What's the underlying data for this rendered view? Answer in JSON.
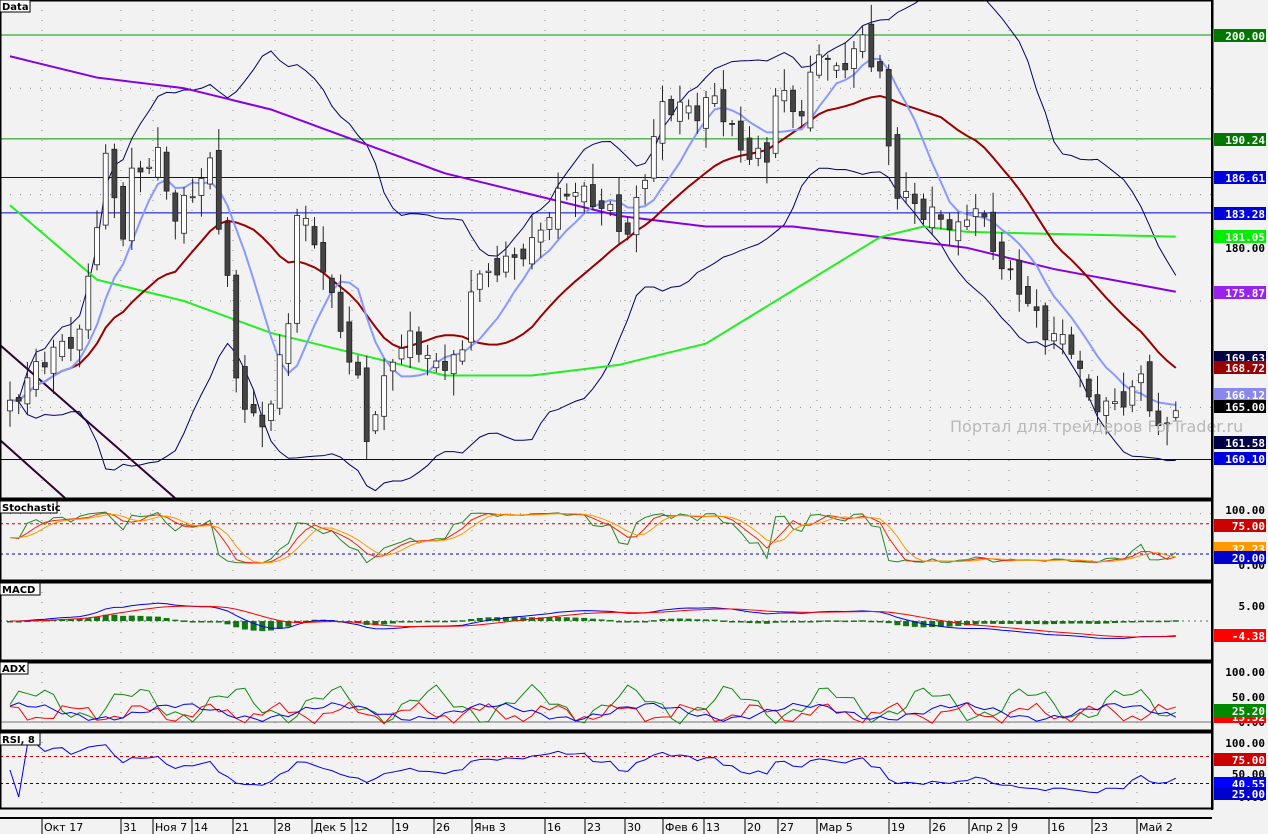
{
  "panels": {
    "data": "Data",
    "stochastic": "Stochastic",
    "macd": "MACD",
    "adx": "ADX",
    "rsi": "RSI, 8"
  },
  "watermark": "Портал для трейдеров ForTrader.ru",
  "price_axis": {
    "ticks": [
      "180.00",
      "165.00"
    ],
    "tags": [
      {
        "text": "200.00",
        "bg": "#007700"
      },
      {
        "text": "190.24",
        "bg": "#007700"
      },
      {
        "text": "186.61",
        "bg": "#0000dd"
      },
      {
        "text": "183.28",
        "bg": "#0000dd"
      },
      {
        "text": "181.05",
        "bg": "#00ee00"
      },
      {
        "text": "175.87",
        "bg": "#9922ee"
      },
      {
        "text": "169.63",
        "bg": "#000044"
      },
      {
        "text": "168.72",
        "bg": "#990000"
      },
      {
        "text": "166.12",
        "bg": "#8888ee"
      },
      {
        "text": "165.00",
        "bg": "#000000"
      },
      {
        "text": "161.58",
        "bg": "#000044"
      },
      {
        "text": "160.10",
        "bg": "#0000dd"
      }
    ]
  },
  "stoch_axis": {
    "ticks": [
      "100.00",
      "0.00"
    ],
    "tags": [
      {
        "text": "75.00",
        "bg": "#cc0000"
      },
      {
        "text": "32.23",
        "bg": "#ff9900"
      },
      {
        "text": "20.00",
        "bg": "#0000cc"
      }
    ]
  },
  "macd_axis": {
    "ticks": [
      "5.00"
    ],
    "tags": [
      {
        "text": "-4.38",
        "bg": "#ff0000"
      }
    ]
  },
  "adx_axis": {
    "ticks": [
      "100.00",
      "50.00",
      "0.00"
    ],
    "tags": [
      {
        "text": "25.20",
        "bg": "#008800"
      },
      {
        "text": "15.52",
        "bg": "#ff0000"
      }
    ]
  },
  "rsi_axis": {
    "ticks": [
      "100.00",
      "50.00",
      "0.00"
    ],
    "tags": [
      {
        "text": "75.00",
        "bg": "#cc0000"
      },
      {
        "text": "40.55",
        "bg": "#0000ff"
      },
      {
        "text": "25.00",
        "bg": "#0000cc"
      }
    ]
  },
  "dates": [
    "Окт 17",
    "31",
    "Ноя 7",
    "14",
    "21",
    "28",
    "Дек 5",
    "12",
    "19",
    "26",
    "Янв 3",
    "16",
    "23",
    "30",
    "Фев 6",
    "13",
    "20",
    "27",
    "Мар 5",
    "19",
    "26",
    "Апр 2",
    "9",
    "16",
    "23",
    "Май 2"
  ],
  "chart_data": {
    "type": "candlestick",
    "bars": 135,
    "ylim": [
      155,
      202
    ],
    "close_keypoints": [
      [
        0,
        165
      ],
      [
        3,
        168
      ],
      [
        8,
        172
      ],
      [
        11,
        189
      ],
      [
        13,
        182
      ],
      [
        14,
        187
      ],
      [
        17,
        188
      ],
      [
        19,
        182
      ],
      [
        23,
        188
      ],
      [
        25,
        178
      ],
      [
        26,
        168
      ],
      [
        29,
        163
      ],
      [
        32,
        172
      ],
      [
        33,
        183
      ],
      [
        36,
        178
      ],
      [
        37,
        175
      ],
      [
        40,
        168
      ],
      [
        41,
        163
      ],
      [
        44,
        170
      ],
      [
        46,
        171
      ],
      [
        49,
        168
      ],
      [
        52,
        170
      ],
      [
        53,
        177
      ],
      [
        56,
        179
      ],
      [
        60,
        180
      ],
      [
        63,
        184
      ],
      [
        65,
        185
      ],
      [
        69,
        184
      ],
      [
        71,
        182
      ],
      [
        75,
        193
      ],
      [
        79,
        192
      ],
      [
        81,
        194
      ],
      [
        84,
        190
      ],
      [
        87,
        189
      ],
      [
        88,
        195
      ],
      [
        91,
        192
      ],
      [
        93,
        198
      ],
      [
        95,
        196
      ],
      [
        98,
        200
      ],
      [
        100,
        197
      ],
      [
        101,
        190
      ],
      [
        102,
        186
      ],
      [
        105,
        183
      ],
      [
        107,
        182
      ],
      [
        109,
        181
      ],
      [
        111,
        184
      ],
      [
        114,
        179
      ],
      [
        116,
        177
      ],
      [
        119,
        172
      ],
      [
        122,
        170
      ],
      [
        124,
        165
      ],
      [
        126,
        165
      ],
      [
        129,
        167
      ],
      [
        130,
        169
      ],
      [
        132,
        163
      ],
      [
        134,
        165
      ]
    ],
    "ma_green_keypoints": [
      [
        0,
        184
      ],
      [
        10,
        177
      ],
      [
        20,
        175
      ],
      [
        30,
        172
      ],
      [
        40,
        170
      ],
      [
        50,
        168
      ],
      [
        60,
        168
      ],
      [
        70,
        169
      ],
      [
        80,
        171
      ],
      [
        90,
        176
      ],
      [
        100,
        181
      ],
      [
        105,
        182
      ],
      [
        110,
        181.5
      ],
      [
        120,
        181.3
      ],
      [
        134,
        181.05
      ]
    ],
    "ma_purple_keypoints": [
      [
        0,
        198
      ],
      [
        10,
        196
      ],
      [
        20,
        195
      ],
      [
        30,
        193
      ],
      [
        40,
        190
      ],
      [
        50,
        187
      ],
      [
        60,
        185
      ],
      [
        70,
        183
      ],
      [
        80,
        182
      ],
      [
        90,
        182
      ],
      [
        100,
        181
      ],
      [
        110,
        180
      ],
      [
        120,
        178
      ],
      [
        134,
        175.87
      ]
    ],
    "hlines": [
      {
        "value": 200,
        "color": "#009900"
      },
      {
        "value": 190.24,
        "color": "#009900"
      },
      {
        "value": 186.61,
        "color": "#0000dd"
      },
      {
        "value": 183.28,
        "color": "#0000dd"
      },
      {
        "value": 160.1,
        "color": "#000066"
      }
    ],
    "stoch_levels": [
      75,
      20
    ],
    "rsi_levels": [
      75,
      25
    ],
    "last": {
      "stoch": 32.23,
      "macd": -4.38,
      "adx": 25.2,
      "rsi": 40.55
    }
  }
}
